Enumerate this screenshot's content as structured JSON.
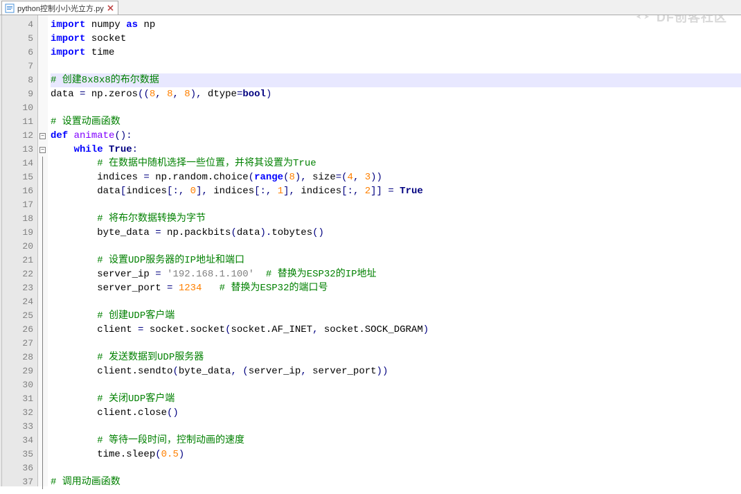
{
  "watermark": {
    "text": "DF创客社区"
  },
  "tab": {
    "filename": "python控制小小光立方.py"
  },
  "gutter": {
    "start": 4,
    "end": 37
  },
  "highlight_line": 8,
  "fold_markers": {
    "12": "minus",
    "13": "minus"
  },
  "fold_vlines_from": 12,
  "fold_vlines_to": 37,
  "code_lines": {
    "4": [
      [
        "kw",
        "import"
      ],
      [
        " "
      ],
      [
        "nm",
        "numpy"
      ],
      [
        " "
      ],
      [
        "kw",
        "as"
      ],
      [
        " "
      ],
      [
        "nm",
        "np"
      ]
    ],
    "5": [
      [
        "kw",
        "import"
      ],
      [
        " "
      ],
      [
        "nm",
        "socket"
      ]
    ],
    "6": [
      [
        "kw",
        "import"
      ],
      [
        " "
      ],
      [
        "nm",
        "time"
      ]
    ],
    "7": [],
    "8": [
      [
        "cm",
        "# 创建8x8x8的布尔数据"
      ]
    ],
    "9": [
      [
        "nm",
        "data "
      ],
      [
        "op",
        "="
      ],
      [
        " np.zeros"
      ],
      [
        "op",
        "(("
      ],
      [
        "num",
        "8"
      ],
      [
        "op",
        ", "
      ],
      [
        "num",
        "8"
      ],
      [
        "op",
        ", "
      ],
      [
        "num",
        "8"
      ],
      [
        "op",
        "), "
      ],
      [
        "nm",
        "dtype"
      ],
      [
        "op",
        "="
      ],
      [
        "bool",
        "bool"
      ],
      [
        "op",
        ")"
      ]
    ],
    "10": [],
    "11": [
      [
        "cm",
        "# 设置动画函数"
      ]
    ],
    "12": [
      [
        "kw",
        "def"
      ],
      [
        " "
      ],
      [
        "def-name",
        "animate"
      ],
      [
        "op",
        "():"
      ]
    ],
    "13": [
      [
        "    "
      ],
      [
        "kw",
        "while"
      ],
      [
        " "
      ],
      [
        "bool",
        "True"
      ],
      [
        "op",
        ":"
      ]
    ],
    "14": [
      [
        "        "
      ],
      [
        "cm",
        "# 在数据中随机选择一些位置，并将其设置为True"
      ]
    ],
    "15": [
      [
        "        indices "
      ],
      [
        "op",
        "="
      ],
      [
        " np.random.choice"
      ],
      [
        "op",
        "("
      ],
      [
        "kw",
        "range"
      ],
      [
        "op",
        "("
      ],
      [
        "num",
        "8"
      ],
      [
        "op",
        "), "
      ],
      [
        "nm",
        "size"
      ],
      [
        "op",
        "=("
      ],
      [
        "num",
        "4"
      ],
      [
        "op",
        ", "
      ],
      [
        "num",
        "3"
      ],
      [
        "op",
        "))"
      ]
    ],
    "16": [
      [
        "        data"
      ],
      [
        "op",
        "["
      ],
      [
        "nm",
        "indices"
      ],
      [
        "op",
        "[:, "
      ],
      [
        "num",
        "0"
      ],
      [
        "op",
        "], "
      ],
      [
        "nm",
        "indices"
      ],
      [
        "op",
        "[:, "
      ],
      [
        "num",
        "1"
      ],
      [
        "op",
        "], "
      ],
      [
        "nm",
        "indices"
      ],
      [
        "op",
        "[:, "
      ],
      [
        "num",
        "2"
      ],
      [
        "op",
        "]] = "
      ],
      [
        "bool",
        "True"
      ]
    ],
    "17": [],
    "18": [
      [
        "        "
      ],
      [
        "cm",
        "# 将布尔数据转换为字节"
      ]
    ],
    "19": [
      [
        "        byte_data "
      ],
      [
        "op",
        "="
      ],
      [
        " np.packbits"
      ],
      [
        "op",
        "("
      ],
      [
        "nm",
        "data"
      ],
      [
        "op",
        ")."
      ],
      [
        "nm",
        "tobytes"
      ],
      [
        "op",
        "()"
      ]
    ],
    "20": [],
    "21": [
      [
        "        "
      ],
      [
        "cm",
        "# 设置UDP服务器的IP地址和端口"
      ]
    ],
    "22": [
      [
        "        server_ip "
      ],
      [
        "op",
        "="
      ],
      [
        " "
      ],
      [
        "str",
        "'192.168.1.100'"
      ],
      [
        "  "
      ],
      [
        "cm",
        "# 替换为ESP32的IP地址"
      ]
    ],
    "23": [
      [
        "        server_port "
      ],
      [
        "op",
        "="
      ],
      [
        " "
      ],
      [
        "num",
        "1234"
      ],
      [
        "   "
      ],
      [
        "cm",
        "# 替换为ESP32的端口号"
      ]
    ],
    "24": [],
    "25": [
      [
        "        "
      ],
      [
        "cm",
        "# 创建UDP客户端"
      ]
    ],
    "26": [
      [
        "        client "
      ],
      [
        "op",
        "="
      ],
      [
        " socket.socket"
      ],
      [
        "op",
        "("
      ],
      [
        "nm",
        "socket.AF_INET"
      ],
      [
        "op",
        ", "
      ],
      [
        "nm",
        "socket.SOCK_DGRAM"
      ],
      [
        "op",
        ")"
      ]
    ],
    "27": [],
    "28": [
      [
        "        "
      ],
      [
        "cm",
        "# 发送数据到UDP服务器"
      ]
    ],
    "29": [
      [
        "        client.sendto"
      ],
      [
        "op",
        "("
      ],
      [
        "nm",
        "byte_data"
      ],
      [
        "op",
        ", ("
      ],
      [
        "nm",
        "server_ip"
      ],
      [
        "op",
        ", "
      ],
      [
        "nm",
        "server_port"
      ],
      [
        "op",
        "))"
      ]
    ],
    "30": [],
    "31": [
      [
        "        "
      ],
      [
        "cm",
        "# 关闭UDP客户端"
      ]
    ],
    "32": [
      [
        "        client.close"
      ],
      [
        "op",
        "()"
      ]
    ],
    "33": [],
    "34": [
      [
        "        "
      ],
      [
        "cm",
        "# 等待一段时间，控制动画的速度"
      ]
    ],
    "35": [
      [
        "        time.sleep"
      ],
      [
        "op",
        "("
      ],
      [
        "num",
        "0.5"
      ],
      [
        "op",
        ")"
      ]
    ],
    "36": [],
    "37": [
      [
        "cm",
        "# 调用动画函数"
      ]
    ]
  }
}
